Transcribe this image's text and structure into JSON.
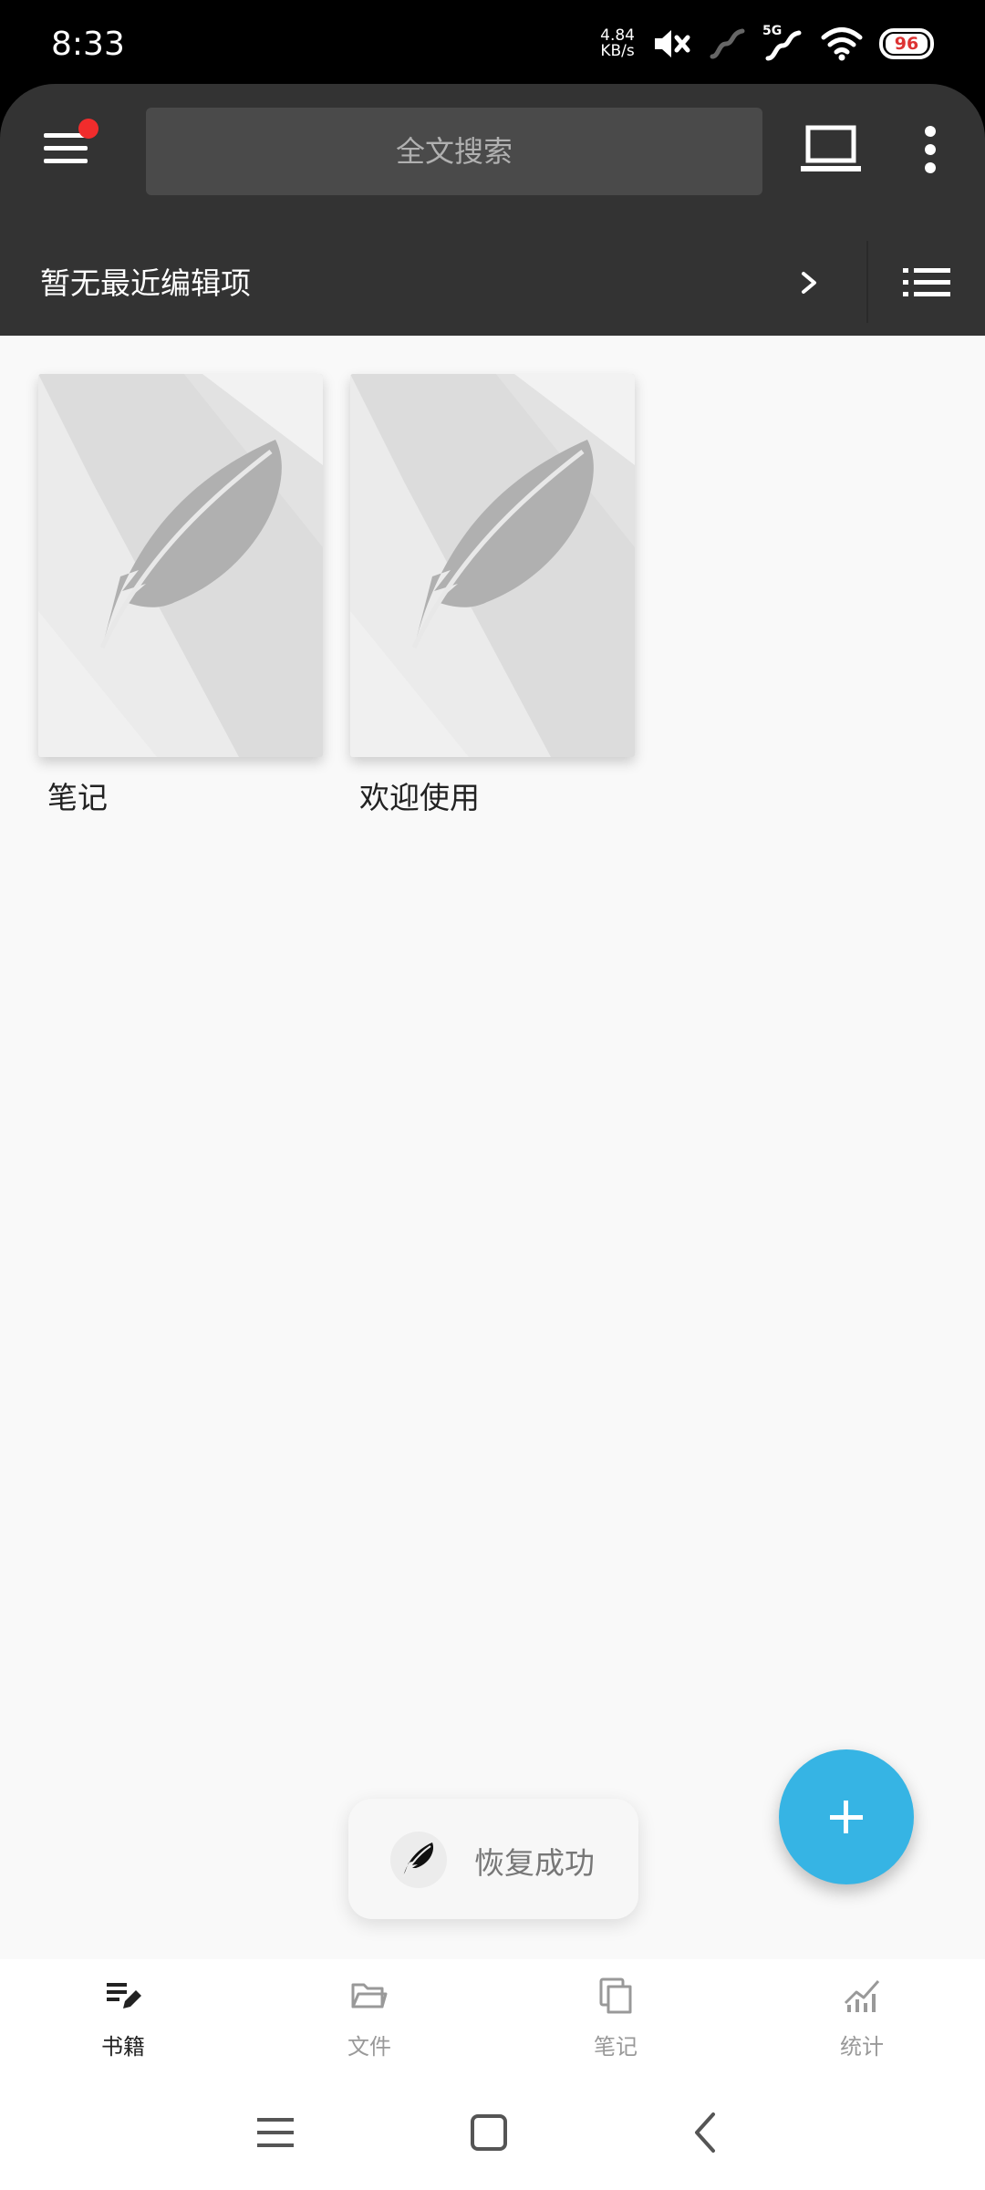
{
  "status_bar": {
    "time": "8:33",
    "net_speed_value": "4.84",
    "net_speed_unit": "KB/s",
    "network_type": "5G",
    "battery": "96"
  },
  "header": {
    "search_placeholder": "全文搜索",
    "recent_label": "暂无最近编辑项"
  },
  "books": [
    {
      "title": "笔记"
    },
    {
      "title": "欢迎使用"
    }
  ],
  "toast": {
    "message": "恢复成功"
  },
  "bottom_nav": {
    "items": [
      {
        "label": "书籍",
        "icon": "books-edit-icon",
        "active": true
      },
      {
        "label": "文件",
        "icon": "folder-icon",
        "active": false
      },
      {
        "label": "笔记",
        "icon": "notes-icon",
        "active": false
      },
      {
        "label": "统计",
        "icon": "stats-icon",
        "active": false
      }
    ]
  },
  "colors": {
    "header_bg": "#333333",
    "accent": "#36b4e4",
    "notification_dot": "#f12c2c",
    "nav_active": "#222222",
    "nav_inactive": "#999999"
  }
}
